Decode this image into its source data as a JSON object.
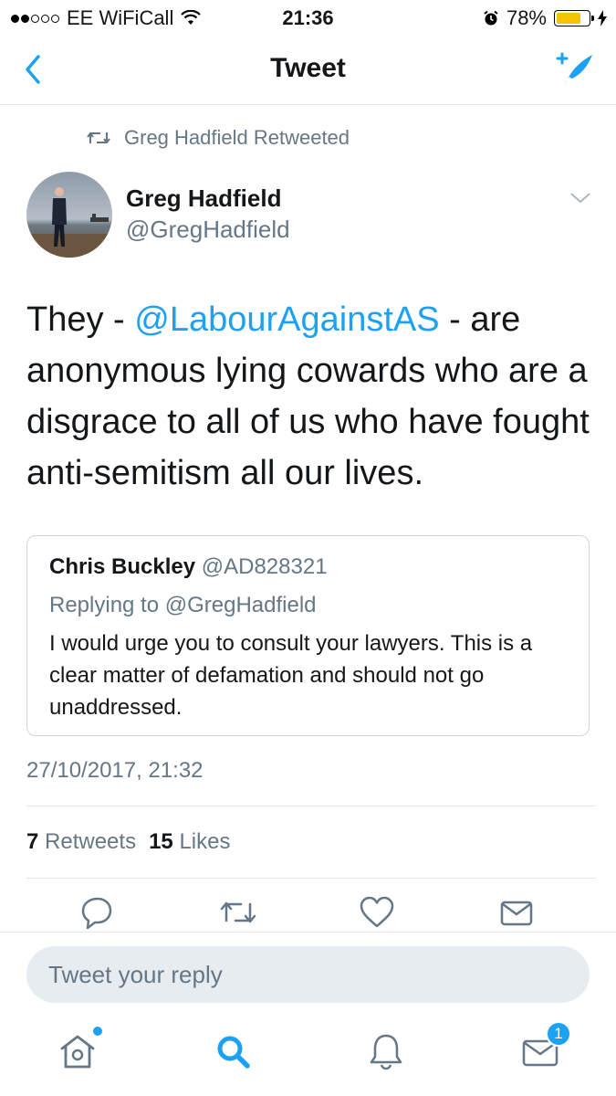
{
  "status_bar": {
    "carrier": "EE WiFiCall",
    "time": "21:36",
    "battery_percent": "78%",
    "battery_level": 0.78
  },
  "nav": {
    "title": "Tweet",
    "accent_color": "#1da1f2"
  },
  "retweet_line": "Greg Hadfield Retweeted",
  "author": {
    "name": "Greg Hadfield",
    "handle": "@GregHadfield"
  },
  "tweet": {
    "text_before": "They - ",
    "mention": "@LabourAgainstAS",
    "text_after": " - are anonymous lying cowards who are a disgrace to all of us who have fought anti-semitism all our lives."
  },
  "quoted_tweet": {
    "name": "Chris Buckley",
    "handle": "@AD828321",
    "replying_to": "Replying to @GregHadfield",
    "text": "I would urge you to consult your lawyers. This is a clear matter of defamation and should not go unaddressed."
  },
  "timestamp": "27/10/2017, 21:32",
  "stats": {
    "retweets_count": "7",
    "retweets_label": "Retweets",
    "likes_count": "15",
    "likes_label": "Likes"
  },
  "actions": {
    "icons": [
      "reply-icon",
      "retweet-icon",
      "like-icon",
      "direct-message-icon"
    ]
  },
  "reply_input": {
    "placeholder": "Tweet your reply"
  },
  "tab_bar": {
    "icons": [
      "home-icon",
      "search-icon",
      "notifications-icon",
      "messages-icon"
    ],
    "messages_badge": "1"
  }
}
